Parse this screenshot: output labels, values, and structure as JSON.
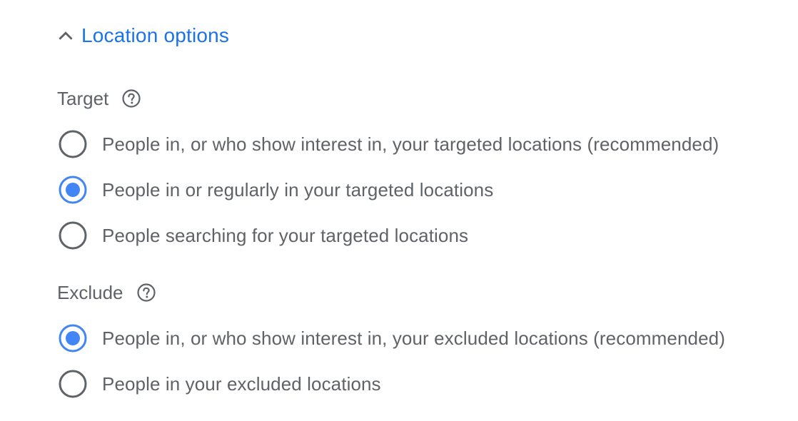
{
  "section": {
    "title": "Location options",
    "expanded": true,
    "icon": "chevron-up-icon"
  },
  "colors": {
    "accent": "#1a73e8",
    "radio_selected": "#4285f4",
    "radio_unselected": "#5f6368",
    "text": "#5f6368"
  },
  "target": {
    "label": "Target",
    "help_icon": "help-circle-icon",
    "options": [
      {
        "label": "People in, or who show interest in, your targeted locations (recommended)",
        "selected": false
      },
      {
        "label": "People in or regularly in your targeted locations",
        "selected": true
      },
      {
        "label": "People searching for your targeted locations",
        "selected": false
      }
    ]
  },
  "exclude": {
    "label": "Exclude",
    "help_icon": "help-circle-icon",
    "options": [
      {
        "label": "People in, or who show interest in, your excluded locations (recommended)",
        "selected": true
      },
      {
        "label": "People in your excluded locations",
        "selected": false
      }
    ]
  }
}
